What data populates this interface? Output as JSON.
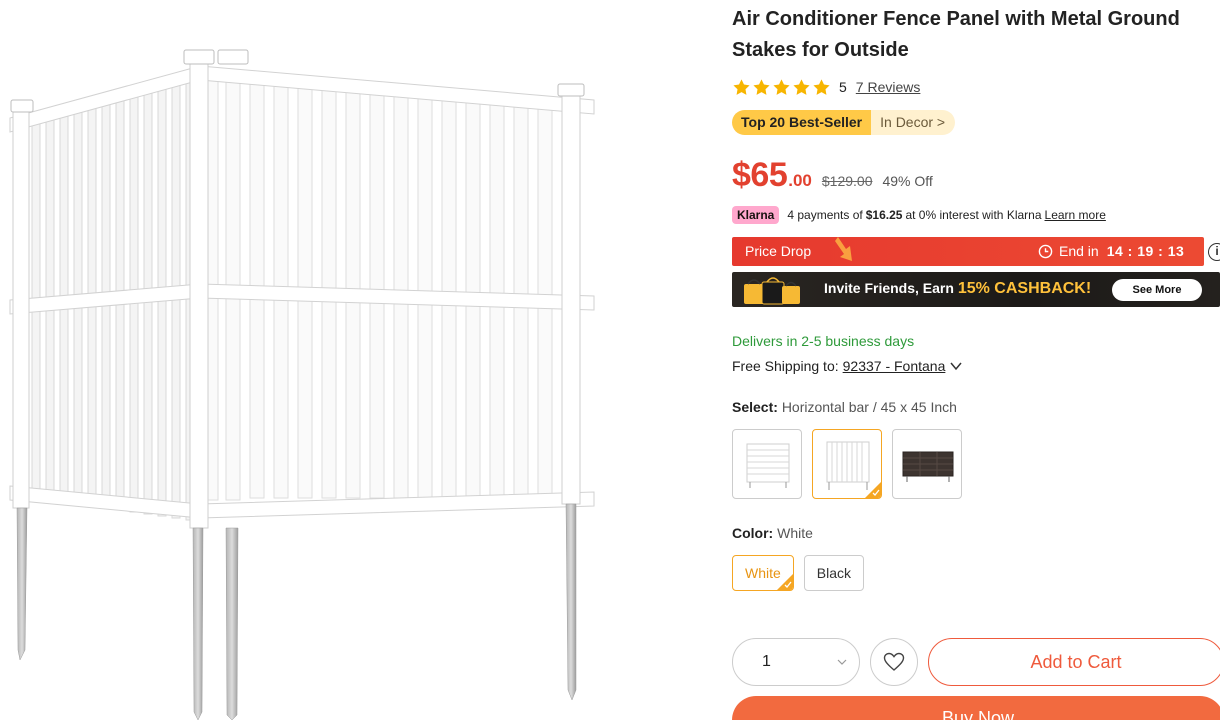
{
  "product": {
    "title": "Air Conditioner Fence Panel with Metal Ground Stakes for Outside",
    "rating": "5",
    "rating_value": 5,
    "reviews_label": "7 Reviews"
  },
  "badge": {
    "bestseller": "Top 20 Best-Seller",
    "category": "In Decor >"
  },
  "price": {
    "main": "$65",
    "cents": ".00",
    "original": "$129.00",
    "discount": "49% Off"
  },
  "klarna": {
    "badge": "Klarna",
    "prefix": "4 payments of",
    "amount": "$16.25",
    "suffix": "at 0% interest with Klarna",
    "link": "Learn more"
  },
  "price_drop": {
    "label": "Price Drop",
    "end_label": "End in",
    "countdown": "14 : 19 : 13",
    "info": "i"
  },
  "promo": {
    "text": "Invite Friends, Earn",
    "highlight": "15% CASHBACK!",
    "button": "See More"
  },
  "delivery": {
    "delivers": "Delivers in 2-5 business days",
    "shipping_label": "Free Shipping to:",
    "zip": "92337 - Fontana"
  },
  "select": {
    "label": "Select:",
    "value": "Horizontal bar / 45 x 45 Inch"
  },
  "color": {
    "label": "Color:",
    "value": "White",
    "options": [
      "White",
      "Black"
    ]
  },
  "purchase": {
    "quantity": "1",
    "add_to_cart": "Add to Cart",
    "buy_now": "Buy Now"
  },
  "colors": {
    "accent": "#e2412f",
    "brand_orange": "#f26a3f",
    "selected_border": "#f5a623",
    "success_green": "#2e9a3a"
  }
}
